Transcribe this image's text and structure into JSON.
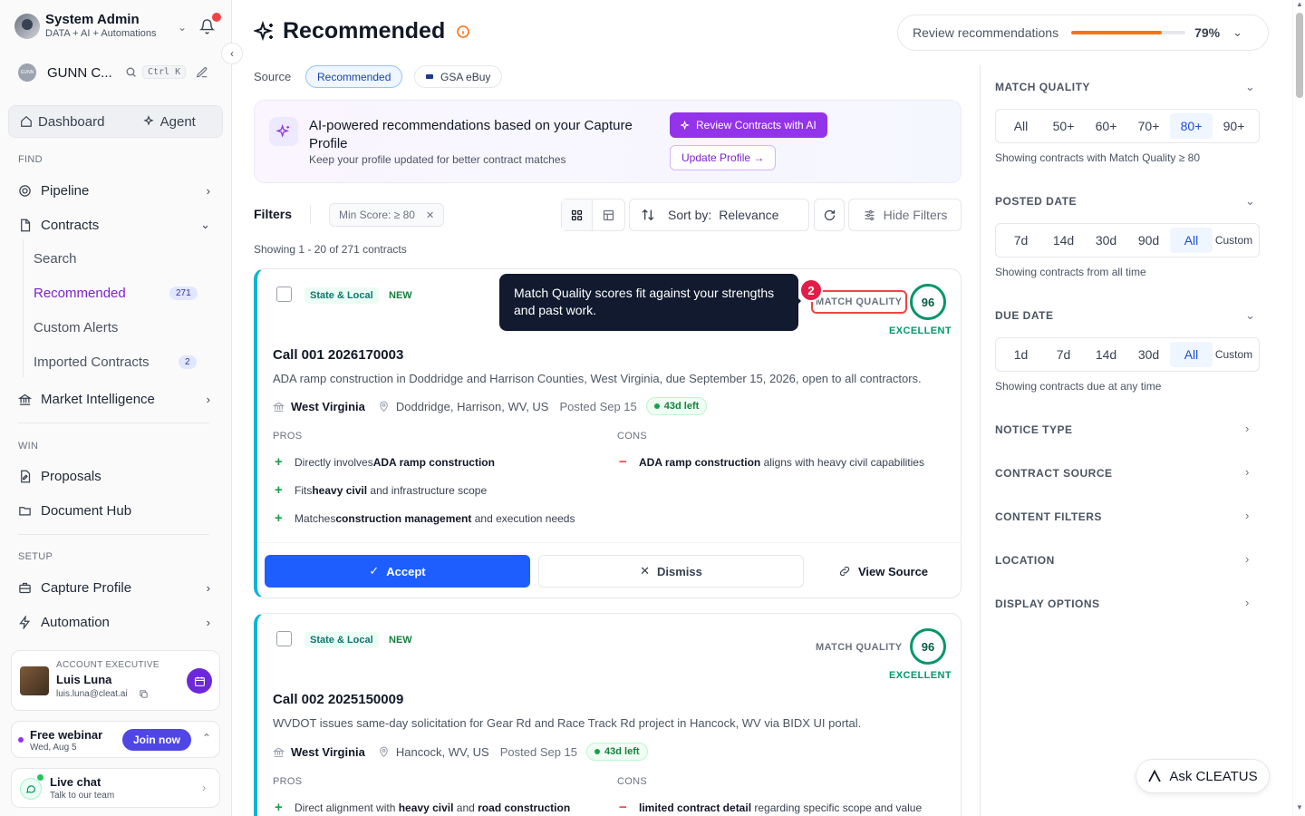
{
  "user": {
    "name": "System Admin",
    "subtitle": "DATA + AI + Automations"
  },
  "org": {
    "name": "GUNN C...",
    "logo_text": "GUNN",
    "shortcut": "Ctrl K"
  },
  "topnav": {
    "dashboard": "Dashboard",
    "agent": "Agent"
  },
  "sections": {
    "find": "FIND",
    "win": "WIN",
    "setup": "SETUP"
  },
  "nav": {
    "pipeline": "Pipeline",
    "contracts": "Contracts",
    "search": "Search",
    "recommended": "Recommended",
    "recommended_count": "271",
    "custom_alerts": "Custom Alerts",
    "imported": "Imported Contracts",
    "imported_count": "2",
    "market": "Market Intelligence",
    "proposals": "Proposals",
    "document_hub": "Document Hub",
    "capture_profile": "Capture Profile",
    "automation": "Automation"
  },
  "exec": {
    "role": "ACCOUNT EXECUTIVE",
    "name": "Luis Luna",
    "email": "luis.luna@cleat.ai"
  },
  "webinar": {
    "title": "Free webinar",
    "date": "Wed, Aug 5",
    "cta": "Join now"
  },
  "chat": {
    "title": "Live chat",
    "subtitle": "Talk to our team"
  },
  "page": {
    "title": "Recommended"
  },
  "review": {
    "label": "Review recommendations",
    "percent": "79%",
    "progress": 0.79
  },
  "source": {
    "label": "Source",
    "options": [
      "Recommended",
      "GSA eBuy"
    ]
  },
  "banner": {
    "title": "AI-powered recommendations based on your Capture Profile",
    "subtitle": "Keep your profile updated for better contract matches",
    "btn_review": "Review Contracts with AI",
    "btn_update": "Update Profile →"
  },
  "filters": {
    "label": "Filters",
    "chip": "Min Score: ≥ 80",
    "sort_prefix": "Sort by:",
    "sort_value": "Relevance",
    "hide": "Hide Filters"
  },
  "showing": "Showing 1 - 20 of 271 contracts",
  "tooltip": {
    "text": "Match Quality scores fit against your strengths and past work.",
    "step": "2"
  },
  "cards": [
    {
      "tag": "State & Local",
      "status": "NEW",
      "mq_label": "MATCH QUALITY",
      "score": "96",
      "grade": "EXCELLENT",
      "title": "Call 001 2026170003",
      "desc": "ADA ramp construction in Doddridge and Harrison Counties, West Virginia, due September 15, 2026, open to all contractors.",
      "state": "West Virginia",
      "location": "Doddridge, Harrison, WV, US",
      "posted": "Posted Sep 15",
      "left": "43d left",
      "pros_label": "PROS",
      "cons_label": "CONS",
      "pros": [
        {
          "pre": "Directly involves ",
          "bold": "ADA ramp construction",
          "post": ""
        },
        {
          "pre": "Fits ",
          "bold": "heavy civil",
          "post": " and infrastructure scope"
        },
        {
          "pre": "Matches ",
          "bold": "construction management",
          "post": " and execution needs"
        }
      ],
      "cons": [
        {
          "pre": "",
          "bold": "ADA ramp construction",
          "post": " aligns with heavy civil capabilities"
        }
      ],
      "accept": "Accept",
      "dismiss": "Dismiss",
      "view": "View Source"
    },
    {
      "tag": "State & Local",
      "status": "NEW",
      "mq_label": "MATCH QUALITY",
      "score": "96",
      "grade": "EXCELLENT",
      "title": "Call 002 2025150009",
      "desc": "WVDOT issues same-day solicitation for Gear Rd and Race Track Rd project in Hancock, WV via BIDX UI portal.",
      "state": "West Virginia",
      "location": "Hancock, WV, US",
      "posted": "Posted Sep 15",
      "left": "43d left",
      "pros_label": "PROS",
      "cons_label": "CONS",
      "pros": [
        {
          "pre": "Direct alignment with ",
          "bold": "heavy civil",
          "post": " and ",
          "bold2": "road construction"
        }
      ],
      "cons": [
        {
          "pre": "",
          "bold": "limited contract detail",
          "post": " regarding specific scope and value"
        }
      ]
    }
  ],
  "panel": {
    "match_quality": {
      "title": "MATCH QUALITY",
      "options": [
        "All",
        "50+",
        "60+",
        "70+",
        "80+",
        "90+"
      ],
      "selected": "80+",
      "note": "Showing contracts with Match Quality ≥ 80"
    },
    "posted_date": {
      "title": "POSTED DATE",
      "options": [
        "7d",
        "14d",
        "30d",
        "90d",
        "All",
        "Custom"
      ],
      "selected": "All",
      "note": "Showing contracts from all time"
    },
    "due_date": {
      "title": "DUE DATE",
      "options": [
        "1d",
        "7d",
        "14d",
        "30d",
        "All",
        "Custom"
      ],
      "selected": "All",
      "note": "Showing contracts due at any time"
    },
    "collapsed": [
      "NOTICE TYPE",
      "CONTRACT SOURCE",
      "CONTENT FILTERS",
      "LOCATION",
      "DISPLAY OPTIONS"
    ]
  },
  "ask": "Ask CLEATUS"
}
